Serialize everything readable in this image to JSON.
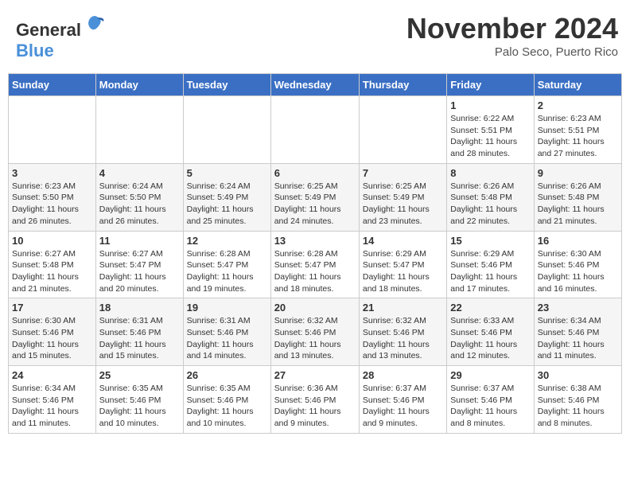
{
  "header": {
    "logo_general": "General",
    "logo_blue": "Blue",
    "month_title": "November 2024",
    "location": "Palo Seco, Puerto Rico"
  },
  "weekdays": [
    "Sunday",
    "Monday",
    "Tuesday",
    "Wednesday",
    "Thursday",
    "Friday",
    "Saturday"
  ],
  "weeks": [
    [
      {
        "day": "",
        "info": ""
      },
      {
        "day": "",
        "info": ""
      },
      {
        "day": "",
        "info": ""
      },
      {
        "day": "",
        "info": ""
      },
      {
        "day": "",
        "info": ""
      },
      {
        "day": "1",
        "info": "Sunrise: 6:22 AM\nSunset: 5:51 PM\nDaylight: 11 hours and 28 minutes."
      },
      {
        "day": "2",
        "info": "Sunrise: 6:23 AM\nSunset: 5:51 PM\nDaylight: 11 hours and 27 minutes."
      }
    ],
    [
      {
        "day": "3",
        "info": "Sunrise: 6:23 AM\nSunset: 5:50 PM\nDaylight: 11 hours and 26 minutes."
      },
      {
        "day": "4",
        "info": "Sunrise: 6:24 AM\nSunset: 5:50 PM\nDaylight: 11 hours and 26 minutes."
      },
      {
        "day": "5",
        "info": "Sunrise: 6:24 AM\nSunset: 5:49 PM\nDaylight: 11 hours and 25 minutes."
      },
      {
        "day": "6",
        "info": "Sunrise: 6:25 AM\nSunset: 5:49 PM\nDaylight: 11 hours and 24 minutes."
      },
      {
        "day": "7",
        "info": "Sunrise: 6:25 AM\nSunset: 5:49 PM\nDaylight: 11 hours and 23 minutes."
      },
      {
        "day": "8",
        "info": "Sunrise: 6:26 AM\nSunset: 5:48 PM\nDaylight: 11 hours and 22 minutes."
      },
      {
        "day": "9",
        "info": "Sunrise: 6:26 AM\nSunset: 5:48 PM\nDaylight: 11 hours and 21 minutes."
      }
    ],
    [
      {
        "day": "10",
        "info": "Sunrise: 6:27 AM\nSunset: 5:48 PM\nDaylight: 11 hours and 21 minutes."
      },
      {
        "day": "11",
        "info": "Sunrise: 6:27 AM\nSunset: 5:47 PM\nDaylight: 11 hours and 20 minutes."
      },
      {
        "day": "12",
        "info": "Sunrise: 6:28 AM\nSunset: 5:47 PM\nDaylight: 11 hours and 19 minutes."
      },
      {
        "day": "13",
        "info": "Sunrise: 6:28 AM\nSunset: 5:47 PM\nDaylight: 11 hours and 18 minutes."
      },
      {
        "day": "14",
        "info": "Sunrise: 6:29 AM\nSunset: 5:47 PM\nDaylight: 11 hours and 18 minutes."
      },
      {
        "day": "15",
        "info": "Sunrise: 6:29 AM\nSunset: 5:46 PM\nDaylight: 11 hours and 17 minutes."
      },
      {
        "day": "16",
        "info": "Sunrise: 6:30 AM\nSunset: 5:46 PM\nDaylight: 11 hours and 16 minutes."
      }
    ],
    [
      {
        "day": "17",
        "info": "Sunrise: 6:30 AM\nSunset: 5:46 PM\nDaylight: 11 hours and 15 minutes."
      },
      {
        "day": "18",
        "info": "Sunrise: 6:31 AM\nSunset: 5:46 PM\nDaylight: 11 hours and 15 minutes."
      },
      {
        "day": "19",
        "info": "Sunrise: 6:31 AM\nSunset: 5:46 PM\nDaylight: 11 hours and 14 minutes."
      },
      {
        "day": "20",
        "info": "Sunrise: 6:32 AM\nSunset: 5:46 PM\nDaylight: 11 hours and 13 minutes."
      },
      {
        "day": "21",
        "info": "Sunrise: 6:32 AM\nSunset: 5:46 PM\nDaylight: 11 hours and 13 minutes."
      },
      {
        "day": "22",
        "info": "Sunrise: 6:33 AM\nSunset: 5:46 PM\nDaylight: 11 hours and 12 minutes."
      },
      {
        "day": "23",
        "info": "Sunrise: 6:34 AM\nSunset: 5:46 PM\nDaylight: 11 hours and 11 minutes."
      }
    ],
    [
      {
        "day": "24",
        "info": "Sunrise: 6:34 AM\nSunset: 5:46 PM\nDaylight: 11 hours and 11 minutes."
      },
      {
        "day": "25",
        "info": "Sunrise: 6:35 AM\nSunset: 5:46 PM\nDaylight: 11 hours and 10 minutes."
      },
      {
        "day": "26",
        "info": "Sunrise: 6:35 AM\nSunset: 5:46 PM\nDaylight: 11 hours and 10 minutes."
      },
      {
        "day": "27",
        "info": "Sunrise: 6:36 AM\nSunset: 5:46 PM\nDaylight: 11 hours and 9 minutes."
      },
      {
        "day": "28",
        "info": "Sunrise: 6:37 AM\nSunset: 5:46 PM\nDaylight: 11 hours and 9 minutes."
      },
      {
        "day": "29",
        "info": "Sunrise: 6:37 AM\nSunset: 5:46 PM\nDaylight: 11 hours and 8 minutes."
      },
      {
        "day": "30",
        "info": "Sunrise: 6:38 AM\nSunset: 5:46 PM\nDaylight: 11 hours and 8 minutes."
      }
    ]
  ]
}
